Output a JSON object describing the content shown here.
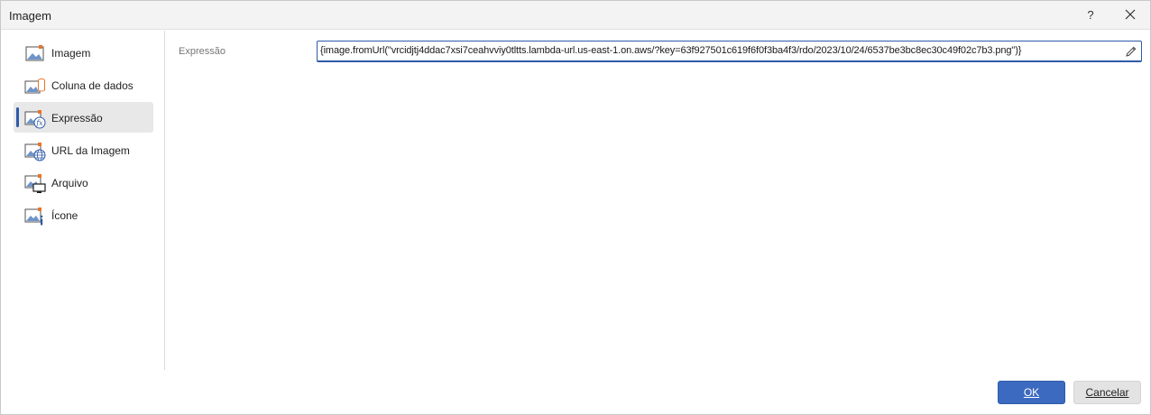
{
  "window": {
    "title": "Imagem",
    "help_label": "?"
  },
  "sidebar": {
    "items": [
      {
        "label": "Imagem",
        "icon": "image-icon"
      },
      {
        "label": "Coluna de dados",
        "icon": "image-data-column-icon"
      },
      {
        "label": "Expressão",
        "icon": "image-expression-icon",
        "active": true
      },
      {
        "label": "URL da Imagem",
        "icon": "image-url-globe-icon"
      },
      {
        "label": "Arquivo",
        "icon": "image-file-monitor-icon"
      },
      {
        "label": "Ícone",
        "icon": "image-info-icon"
      }
    ]
  },
  "main": {
    "expression_label": "Expressão",
    "expression_value": "{image.fromUrl(\"vrcidjtj4ddac7xsi7ceahvviy0tltts.lambda-url.us-east-1.on.aws/?key=63f927501c619f6f0f3ba4f3/rdo/2023/10/24/6537be3bc8ec30c49f02c7b3.png\")}"
  },
  "footer": {
    "ok_label": "OK",
    "cancel_label": "Cancelar"
  },
  "colors": {
    "accent": "#2f5aa8",
    "ok_button": "#3c6ac0",
    "icon_orange": "#e8742a"
  }
}
